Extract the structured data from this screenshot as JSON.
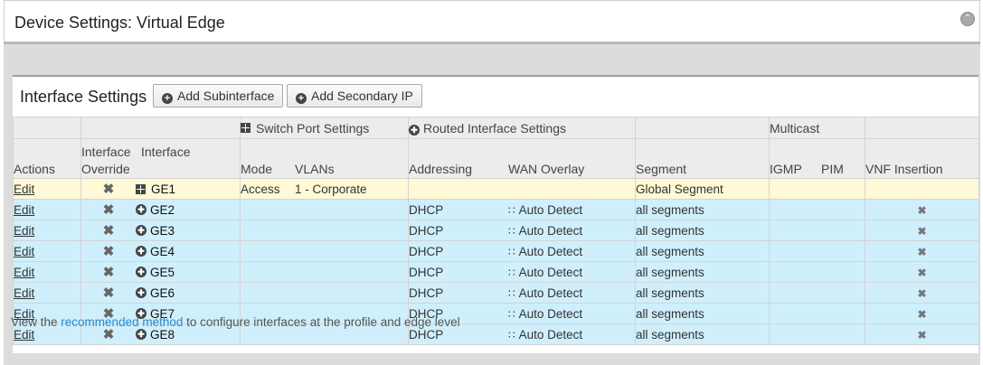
{
  "header": {
    "title": "Device Settings: Virtual Edge",
    "collapse_icon": "chevron-up-icon"
  },
  "interface_settings": {
    "title": "Interface Settings",
    "add_subinterface_label": "Add Subinterface",
    "add_secondary_ip_label": "Add Secondary IP",
    "group_headers": {
      "switch_port": "Switch Port Settings",
      "routed": "Routed Interface Settings",
      "multicast": "Multicast"
    },
    "columns": {
      "actions": "Actions",
      "override": "Interface Override",
      "interface": "Interface",
      "mode": "Mode",
      "vlans": "VLANs",
      "addressing": "Addressing",
      "wan_overlay": "WAN Overlay",
      "segment": "Segment",
      "igmp": "IGMP",
      "pim": "PIM",
      "vnf": "VNF Insertion"
    },
    "rows": [
      {
        "action": "Edit",
        "interface": "GE1",
        "type": "switch",
        "mode": "Access",
        "vlans": "1 - Corporate",
        "addressing": "",
        "wan_overlay": "",
        "segment": "Global Segment",
        "vnf": ""
      },
      {
        "action": "Edit",
        "interface": "GE2",
        "type": "routed",
        "mode": "",
        "vlans": "",
        "addressing": "DHCP",
        "wan_overlay": "Auto Detect",
        "segment": "all segments",
        "vnf": "x"
      },
      {
        "action": "Edit",
        "interface": "GE3",
        "type": "routed",
        "mode": "",
        "vlans": "",
        "addressing": "DHCP",
        "wan_overlay": "Auto Detect",
        "segment": "all segments",
        "vnf": "x"
      },
      {
        "action": "Edit",
        "interface": "GE4",
        "type": "routed",
        "mode": "",
        "vlans": "",
        "addressing": "DHCP",
        "wan_overlay": "Auto Detect",
        "segment": "all segments",
        "vnf": "x"
      },
      {
        "action": "Edit",
        "interface": "GE5",
        "type": "routed",
        "mode": "",
        "vlans": "",
        "addressing": "DHCP",
        "wan_overlay": "Auto Detect",
        "segment": "all segments",
        "vnf": "x"
      },
      {
        "action": "Edit",
        "interface": "GE6",
        "type": "routed",
        "mode": "",
        "vlans": "",
        "addressing": "DHCP",
        "wan_overlay": "Auto Detect",
        "segment": "all segments",
        "vnf": "x"
      },
      {
        "action": "Edit",
        "interface": "GE7",
        "type": "routed",
        "mode": "",
        "vlans": "",
        "addressing": "DHCP",
        "wan_overlay": "Auto Detect",
        "segment": "all segments",
        "vnf": "x"
      },
      {
        "action": "Edit",
        "interface": "GE8",
        "type": "routed",
        "mode": "",
        "vlans": "",
        "addressing": "DHCP",
        "wan_overlay": "Auto Detect",
        "segment": "all segments",
        "vnf": "x"
      }
    ]
  },
  "footnote": {
    "prefix": "View the ",
    "link": "recommended method",
    "suffix": " to configure interfaces at the profile and edge level"
  },
  "colors": {
    "selected_row": "#fff9d6",
    "alt_row": "#cfeffc",
    "link": "#2a88c8"
  }
}
